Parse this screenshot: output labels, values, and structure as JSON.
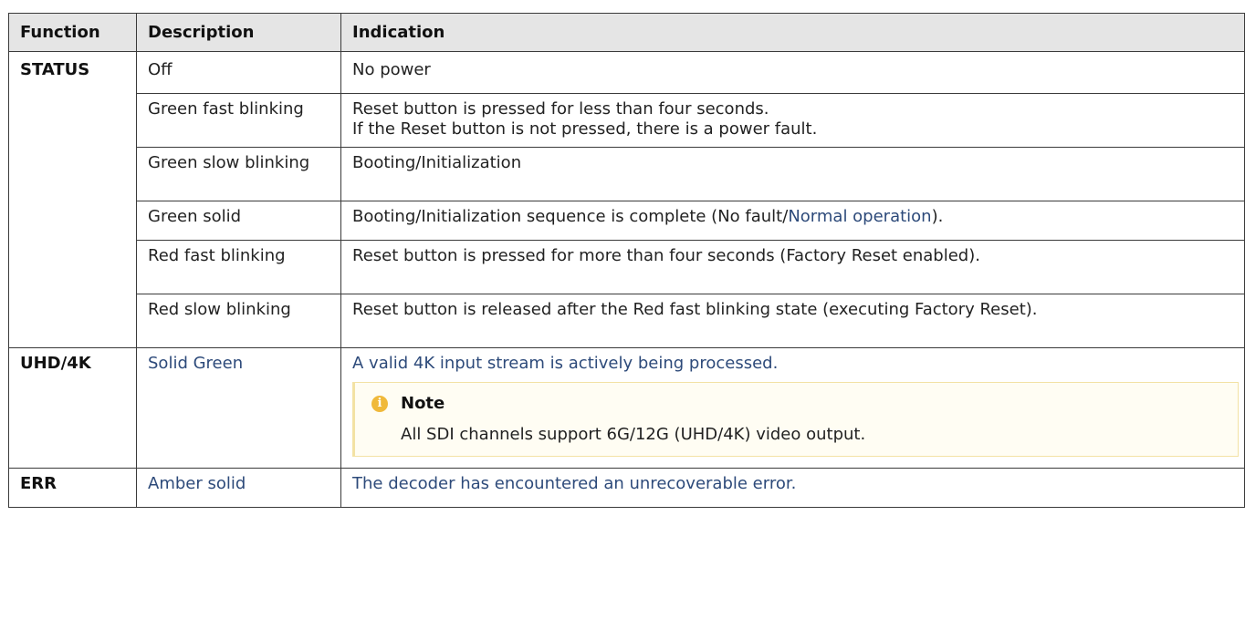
{
  "table": {
    "headers": {
      "function": "Function",
      "description": "Description",
      "indication": "Indication"
    },
    "status": {
      "function": "STATUS",
      "rows": [
        {
          "description": "Off",
          "indication": [
            "No power"
          ]
        },
        {
          "description": "Green fast blinking",
          "indication": [
            "Reset button is pressed for less than four seconds.",
            "If the Reset button is not pressed, there is a power fault."
          ]
        },
        {
          "description": "Green slow blinking",
          "indication": [
            "Booting/Initialization"
          ]
        },
        {
          "description": "Green solid",
          "indication_prefix": "Booting/Initialization sequence is complete (No fault/",
          "indication_link": "Normal operation",
          "indication_suffix": ")."
        },
        {
          "description": "Red fast blinking",
          "indication": [
            "Reset button is pressed for more than four seconds (Factory Reset enabled)."
          ]
        },
        {
          "description": "Red slow blinking",
          "indication": [
            "Reset button is released after the Red fast blinking state (executing Factory Reset)."
          ]
        }
      ]
    },
    "uhd": {
      "function": "UHD/4K",
      "description": "Solid Green",
      "indication": "A valid 4K input stream is actively being processed.",
      "note": {
        "title": "Note",
        "icon": "info-icon",
        "text": "All SDI channels support 6G/12G (UHD/4K) video output."
      }
    },
    "err": {
      "function": "ERR",
      "description": "Amber solid",
      "indication": "The decoder has encountered an unrecoverable error."
    }
  },
  "colors": {
    "header_bg": "#e5e5e5",
    "link": "#2d4a7a",
    "note_bg": "#fffdf3",
    "note_border": "#f3e2a4",
    "note_icon": "#f0b93a"
  }
}
